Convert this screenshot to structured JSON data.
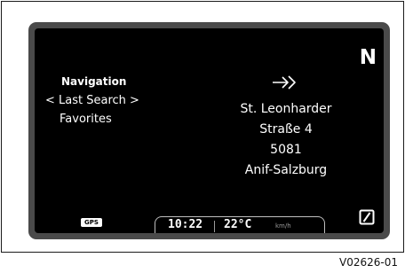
{
  "screen": {
    "compass_heading": "N",
    "menu": {
      "title": "Navigation",
      "selected_item": "< Last Search >",
      "other_item": "Favorites"
    },
    "destination_icon": "arrow-into-target-icon",
    "address_lines": [
      "St. Leonharder",
      "Straße 4",
      "5081",
      "Anif-Salzburg"
    ],
    "status_bar": {
      "gps_label": "GPS",
      "time": "10:22",
      "temperature": "22°C",
      "speed_unit": "km/h"
    },
    "mode_icon": "slashed-square-icon"
  },
  "figure_id": "V02626-01",
  "colors": {
    "bezel": "#4a4a4a",
    "screen": "#000000",
    "text": "#ffffff",
    "muted": "#9a9a9a"
  }
}
